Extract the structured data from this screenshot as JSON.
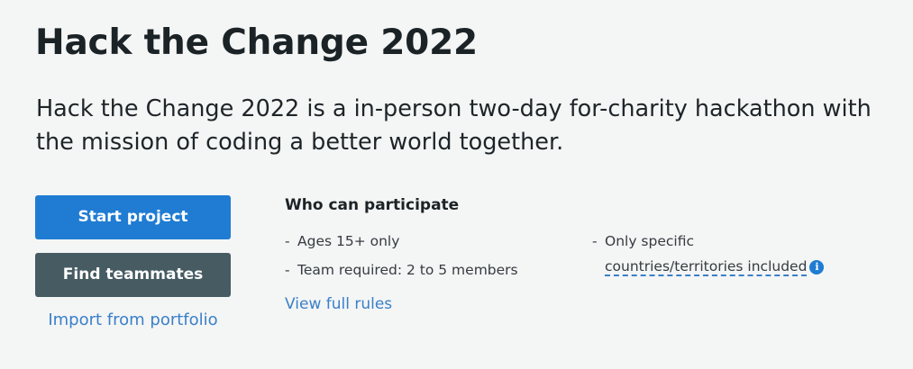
{
  "header": {
    "title": "Hack the Change 2022",
    "tagline": "Hack the Change 2022 is a in-person two-day for-charity hackathon with the mission of coding a better world together."
  },
  "actions": {
    "start_project": "Start project",
    "find_teammates": "Find teammates",
    "import_portfolio": "Import from portfolio"
  },
  "participation": {
    "heading": "Who can participate",
    "requirements": [
      "Ages 15+ only",
      "Team required: 2 to 5 members"
    ],
    "right_requirement_prefix": "Only specific",
    "right_requirement_link": "countries/territories included",
    "view_rules": "View full rules",
    "bullet": "-",
    "info_glyph": "i"
  },
  "colors": {
    "primary": "#1f7cd2",
    "secondary": "#475b63",
    "link": "#3a80c8",
    "background": "#f4f5f5"
  },
  "icons": {
    "info": "info-icon"
  }
}
